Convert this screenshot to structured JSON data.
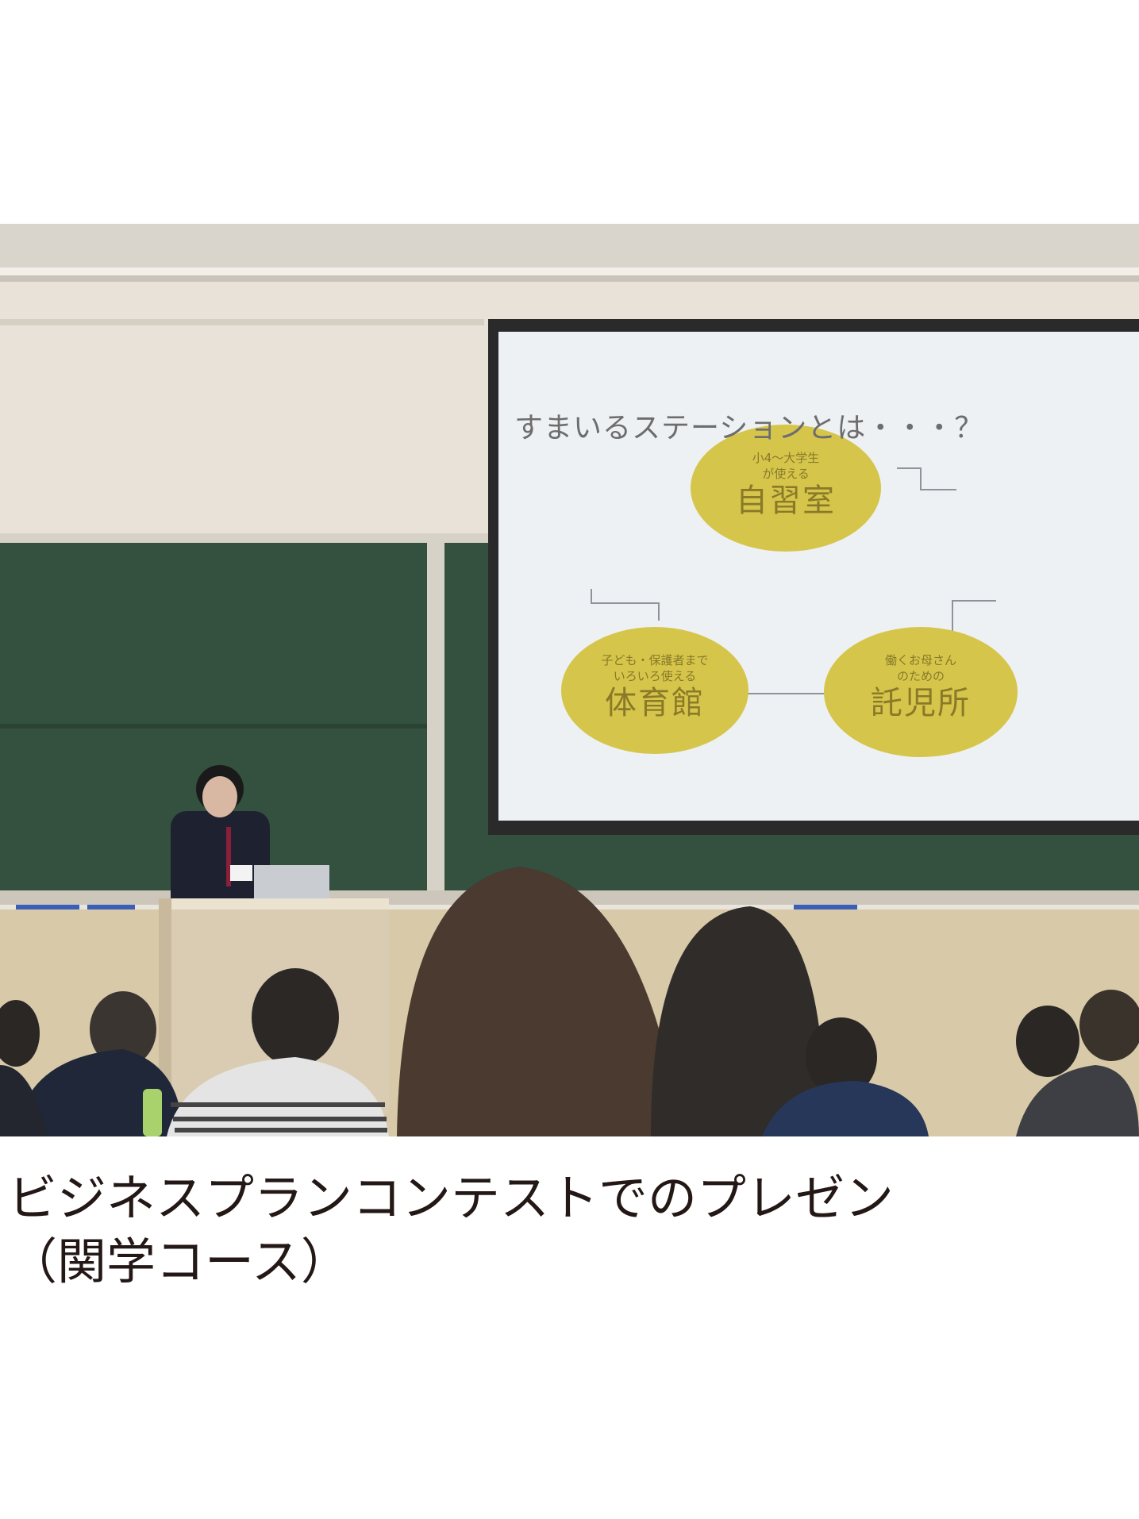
{
  "photo": {
    "slide": {
      "title": "すまいるステーションとは・・・？",
      "bubbles": [
        {
          "small_lines": [
            "小4〜大学生",
            "が使える"
          ],
          "label": "自習室"
        },
        {
          "small_lines": [
            "子ども・保護者まで",
            "いろいろ使える"
          ],
          "label": "体育館"
        },
        {
          "small_lines": [
            "働くお母さん",
            "のための"
          ],
          "label": "託児所"
        }
      ]
    }
  },
  "caption": {
    "line1": "ビジネスプランコンテストでのプレゼン",
    "line2": "（関学コース）"
  }
}
